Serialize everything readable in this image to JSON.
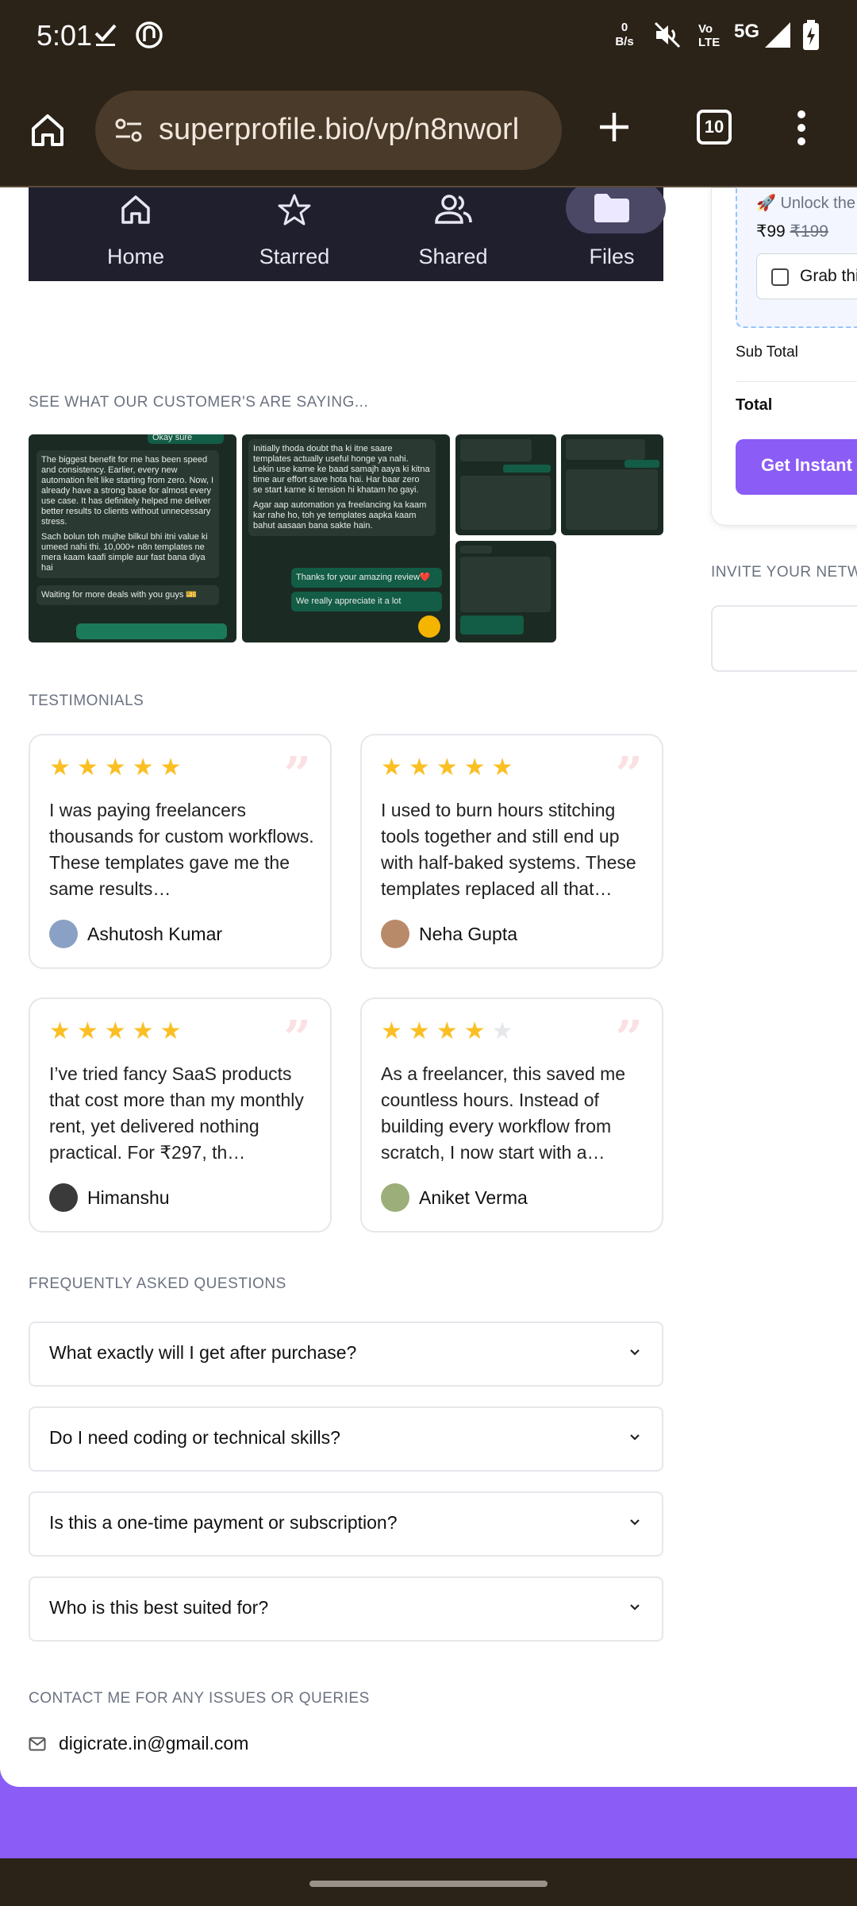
{
  "status_bar": {
    "time": "5:01",
    "net_speed_value": "0",
    "net_speed_unit": "B/s",
    "volte_top": "Vo",
    "volte_bottom": "LTE",
    "network": "5G"
  },
  "browser": {
    "url": "superprofile.bio/vp/n8nworl",
    "tab_count": "10"
  },
  "drive_nav": {
    "items": [
      {
        "label": "Home",
        "icon": "home-icon"
      },
      {
        "label": "Starred",
        "icon": "star-icon"
      },
      {
        "label": "Shared",
        "icon": "people-icon"
      },
      {
        "label": "Files",
        "icon": "folder-icon",
        "active": true
      }
    ]
  },
  "customers_section": {
    "heading": "SEE WHAT OUR CUSTOMER'S ARE SAYING...",
    "shot1": {
      "top_reply": "Okay sure",
      "message": "The biggest benefit for me has been speed and consistency. Earlier, every new automation felt like starting from zero. Now, I already have a strong base for almost every use case. It has definitely helped me deliver better results to clients without unnecessary stress.",
      "message2": "Sach bolun toh mujhe bilkul bhi itni value ki umeed nahi thi. 10,000+ n8n templates ne mera kaam kaafi simple aur fast bana diya hai",
      "footer": "Waiting for more deals with you guys 🎫"
    },
    "shot2": {
      "message": "Initially thoda doubt tha ki itne saare templates actually useful honge ya nahi. Lekin use karne ke baad samajh aaya ki kitna time aur effort save hota hai. Har baar zero se start karne ki tension hi khatam ho gayi.",
      "message2": "Agar aap automation ya freelancing ka kaam kar rahe ho, toh ye templates aapka kaam bahut aasaan bana sakte hain.",
      "reply1": "Thanks for your amazing review❤️",
      "reply2": "We really appreciate it a lot"
    }
  },
  "testimonials": {
    "heading": "TESTIMONIALS",
    "items": [
      {
        "rating": 5,
        "text": "I was paying freelancers thousands for custom workflows. These templates gave me the same results…",
        "author": "Ashutosh Kumar",
        "avatar_color": "#8aa0c4"
      },
      {
        "rating": 5,
        "text": "I used to burn hours stitching tools together and still end up with half-baked systems. These templates replaced all that…",
        "author": "Neha Gupta",
        "avatar_color": "#b98a6a"
      },
      {
        "rating": 5,
        "text": "I’ve tried fancy SaaS products that cost more than my monthly rent, yet delivered nothing practical. For ₹297, th…",
        "author": "Himanshu",
        "avatar_color": "#3a3a3a"
      },
      {
        "rating": 4,
        "text": "As a freelancer, this saved me countless hours. Instead of building every workflow from scratch, I now start with a…",
        "author": "Aniket Verma",
        "avatar_color": "#9cae7a"
      }
    ]
  },
  "faq": {
    "heading": "FREQUENTLY ASKED QUESTIONS",
    "items": [
      "What exactly will I get after purchase?",
      "Do I need coding or technical skills?",
      "Is this a one-time payment or subscription?",
      "Who is this best suited for?"
    ]
  },
  "contact": {
    "heading": "CONTACT ME FOR ANY ISSUES OR QUERIES",
    "email": "digicrate.in@gmail.com"
  },
  "checkout": {
    "unlock_text": "🚀 Unlock the",
    "price": "₹99",
    "old_price": "₹199",
    "grab_label": "Grab thi",
    "subtotal_label": "Sub Total",
    "total_label": "Total",
    "buy_label": "Get Instant",
    "invite_heading": "INVITE YOUR NETWO"
  },
  "colors": {
    "brand": "#8b5cf6",
    "star": "#fbbf24",
    "chrome": "#2b2218"
  }
}
